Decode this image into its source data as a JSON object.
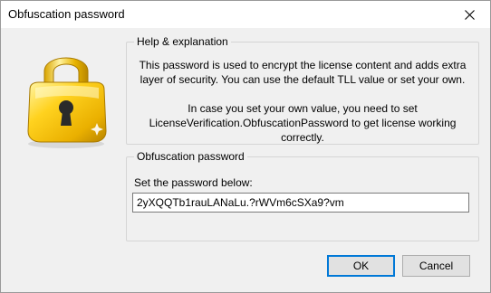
{
  "window": {
    "title": "Obfuscation password"
  },
  "help": {
    "legend": "Help & explanation",
    "paragraph1": "This password is used to encrypt the license content and adds extra layer of security. You can use the default TLL value or set your own.",
    "paragraph2": "In case you set your own value, you need to set LicenseVerification.ObfuscationPassword to get license working correctly."
  },
  "password": {
    "legend": "Obfuscation password",
    "label": "Set the password below:",
    "value": "2yXQQTb1rauLANaLu.?rWVm6cSXa9?vm"
  },
  "buttons": {
    "ok": "OK",
    "cancel": "Cancel"
  },
  "icons": {
    "padlock": "padlock-icon",
    "close": "close-icon"
  },
  "colors": {
    "lock_gold": "#f5c518",
    "default_button_border": "#0078d7"
  }
}
